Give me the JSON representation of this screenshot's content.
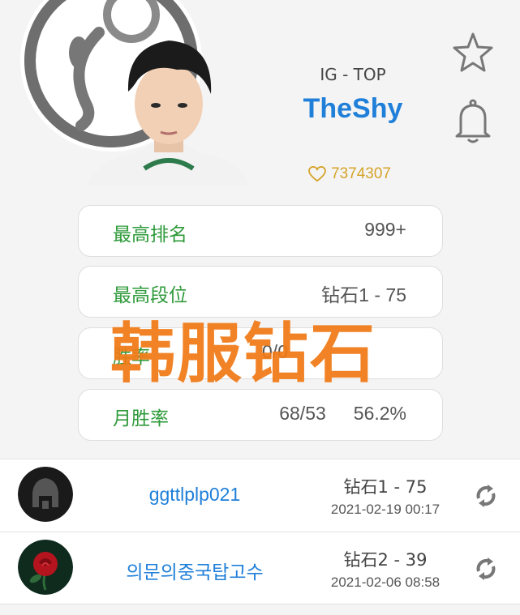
{
  "player": {
    "team_role": "IG - TOP",
    "name": "TheShy",
    "likes": "7374307"
  },
  "stats": [
    {
      "label": "最高排名",
      "value": "999+"
    },
    {
      "label": "最高段位",
      "value": "钻石1 - 75"
    },
    {
      "label": "胜率",
      "value": "0/0"
    },
    {
      "label": "月胜率",
      "value": "68/53",
      "value2": "56.2%"
    }
  ],
  "watermark": "韩服钻石",
  "accounts": [
    {
      "name": "ggttlplp021",
      "rank": "钻石1 - 75",
      "time": "2021-02-19 00:17",
      "avatar_icon": "spartan-helmet-icon"
    },
    {
      "name": "의문의중국탑고수",
      "rank": "钻石2 - 39",
      "time": "2021-02-06 08:58",
      "avatar_icon": "rose-icon"
    }
  ],
  "colors": {
    "accent_blue": "#1f7fd9",
    "label_green": "#2e9a3a",
    "likes_gold": "#d6a32a",
    "watermark_orange": "#f07a16"
  }
}
